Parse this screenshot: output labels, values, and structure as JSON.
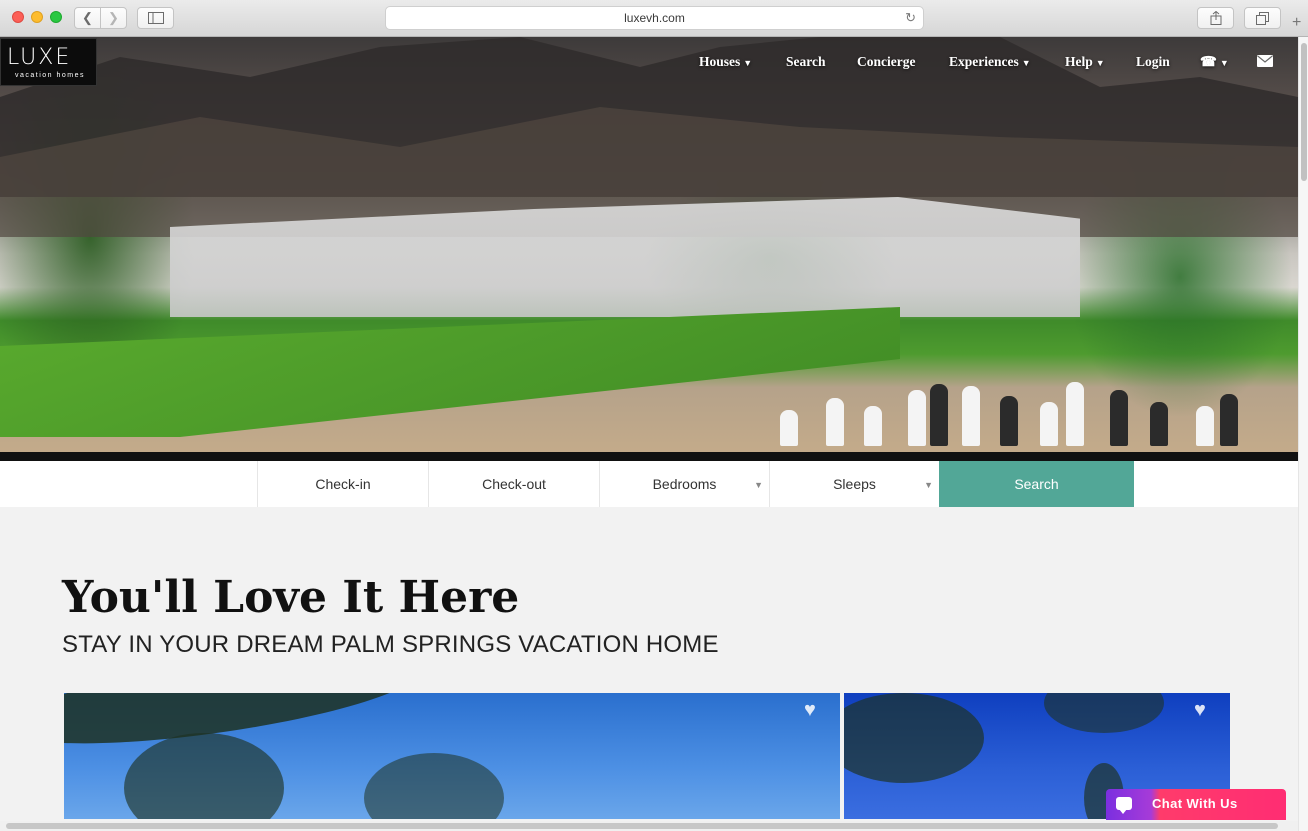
{
  "browser": {
    "url": "luxevh.com",
    "icons": [
      "back-icon",
      "forward-icon",
      "sidebar-icon",
      "reload-icon",
      "share-icon",
      "tabs-icon",
      "new-tab-icon"
    ]
  },
  "site": {
    "logo_text": "LUXE",
    "logo_sub": "vacation homes",
    "nav": [
      {
        "label": "Houses",
        "has_menu": true
      },
      {
        "label": "Search",
        "has_menu": false
      },
      {
        "label": "Concierge",
        "has_menu": false
      },
      {
        "label": "Experiences",
        "has_menu": true
      },
      {
        "label": "Help",
        "has_menu": true
      },
      {
        "label": "Login",
        "has_menu": false
      }
    ],
    "nav_icons": [
      "phone-icon",
      "envelope-icon"
    ]
  },
  "search": {
    "checkin": "Check-in",
    "checkout": "Check-out",
    "bedrooms": "Bedrooms",
    "sleeps": "Sleeps",
    "button": "Search",
    "accent": "#52a797"
  },
  "main": {
    "title": "You'll Love It Here",
    "subtitle": "STAY IN YOUR DREAM PALM SPRINGS VACATION HOME"
  },
  "chat": {
    "label": "Chat With Us"
  }
}
